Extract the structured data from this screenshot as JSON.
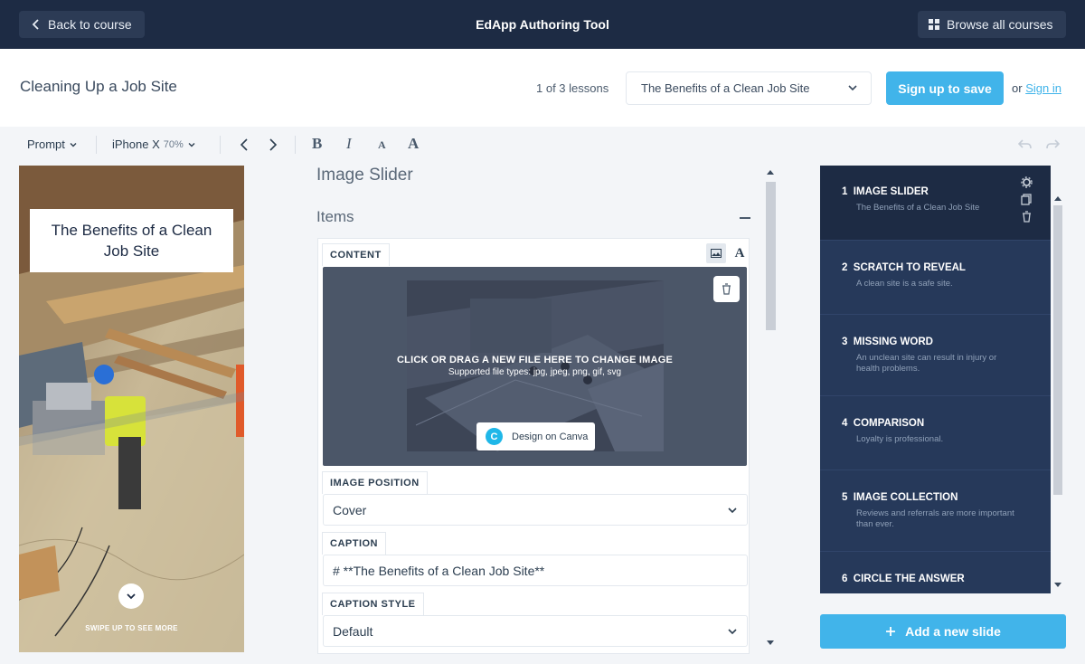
{
  "header": {
    "back_label": "Back to course",
    "app_title": "EdApp Authoring Tool",
    "browse_label": "Browse all courses"
  },
  "lesson_bar": {
    "course_title": "Cleaning Up a Job Site",
    "lesson_count": "1 of 3 lessons",
    "lesson_select": "The Benefits of a Clean Job Site",
    "signup_label": "Sign up to save",
    "or_text": "or",
    "signin_label": "Sign in"
  },
  "toolbar": {
    "mode_label": "Prompt",
    "device_label": "iPhone X",
    "zoom_label": "70%",
    "bold": "B",
    "italic": "I",
    "text_small": "A",
    "text_large": "A"
  },
  "preview": {
    "title": "The Benefits of a Clean Job Site",
    "swipe_hint": "SWIPE UP TO SEE MORE"
  },
  "editor": {
    "section_title": "Image Slider",
    "items_label": "Items",
    "content_tag": "CONTENT",
    "drop_message": "CLICK OR DRAG A NEW FILE HERE TO CHANGE IMAGE",
    "drop_types": "Supported file types: jpg, jpeg, png, gif, svg",
    "canva_label": "Design on Canva",
    "image_position_tag": "IMAGE POSITION",
    "image_position_value": "Cover",
    "caption_tag": "CAPTION",
    "caption_value": "# **The Benefits of a Clean Job Site**",
    "caption_style_tag": "CAPTION STYLE",
    "caption_style_value": "Default"
  },
  "slides": [
    {
      "num": "1",
      "title": "IMAGE SLIDER",
      "desc": "The Benefits of a Clean Job Site"
    },
    {
      "num": "2",
      "title": "SCRATCH TO REVEAL",
      "desc": "A clean site is a safe site."
    },
    {
      "num": "3",
      "title": "MISSING WORD",
      "desc": "An unclean site can result in injury or health problems."
    },
    {
      "num": "4",
      "title": "COMPARISON",
      "desc": "Loyalty is professional."
    },
    {
      "num": "5",
      "title": "IMAGE COLLECTION",
      "desc": "Reviews and referrals are more important than ever."
    },
    {
      "num": "6",
      "title": "CIRCLE THE ANSWER",
      "desc": ""
    }
  ],
  "add_slide_label": "Add a new slide",
  "colors": {
    "nav": "#1d2b44",
    "accent": "#41b4ea",
    "slides_bg": "#26395a"
  }
}
